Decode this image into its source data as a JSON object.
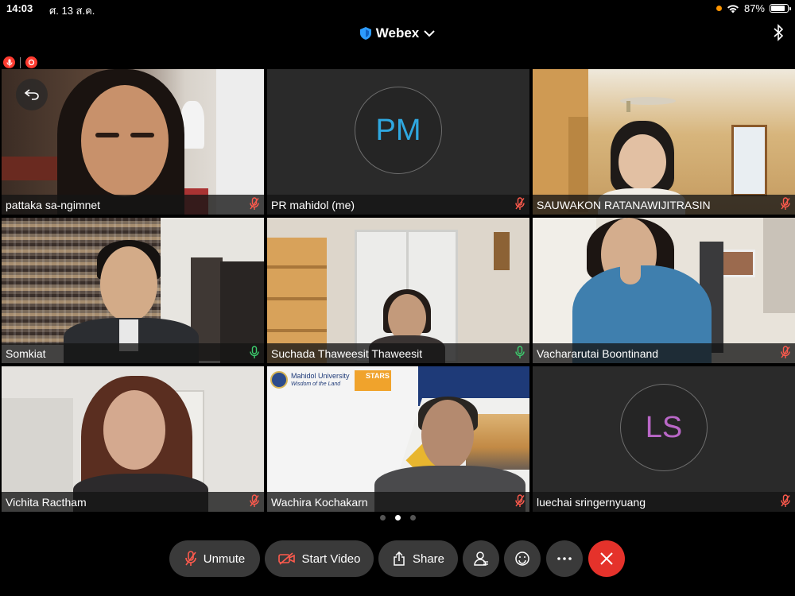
{
  "status": {
    "time": "14:03",
    "date": "ศ. 13 ส.ค.",
    "battery": "87%",
    "battery_level": 0.87
  },
  "app": {
    "title": "Webex"
  },
  "participants": [
    {
      "name": "pattaka sa-ngimnet",
      "mic": "muted",
      "video": true
    },
    {
      "name": "PR mahidol (me)",
      "mic": "muted",
      "video": false,
      "initials": "PM",
      "avatar_color": "#2fa8e0"
    },
    {
      "name": "SAUWAKON RATANAWIJITRASIN",
      "mic": "muted",
      "video": true
    },
    {
      "name": "Somkiat",
      "mic": "active",
      "video": true
    },
    {
      "name": "Suchada Thaweesit Thaweesit",
      "mic": "active",
      "video": true
    },
    {
      "name": "Vachararutai Boontinand",
      "mic": "muted",
      "video": true
    },
    {
      "name": "Vichita Ractham",
      "mic": "muted",
      "video": true
    },
    {
      "name": "Wachira Kochakarn",
      "mic": "muted",
      "video": true
    },
    {
      "name": "luechai sringernyuang",
      "mic": "muted",
      "video": false,
      "initials": "LS",
      "avatar_color": "#b967c7"
    }
  ],
  "slide": {
    "org_line1": "Mahidol University",
    "org_line2": "Wisdom of the Land",
    "badge": "STARS"
  },
  "pagination": {
    "pages": 3,
    "current": 2
  },
  "controls": {
    "unmute": "Unmute",
    "start_video": "Start Video",
    "share": "Share"
  },
  "colors": {
    "muted_icon": "#ff5a4d",
    "active_mic": "#3ccf6e",
    "end_button": "#e5322b",
    "control_bg": "#3a3a3a"
  }
}
